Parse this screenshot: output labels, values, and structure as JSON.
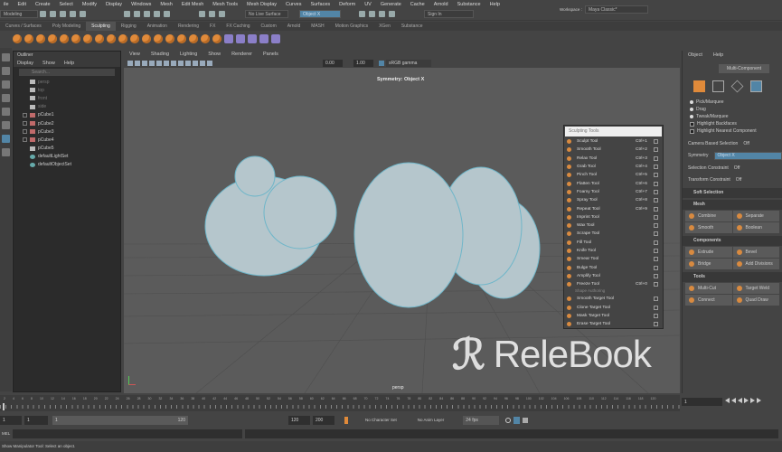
{
  "menubar": [
    "ile",
    "Edit",
    "Create",
    "Select",
    "Modify",
    "Display",
    "Windows",
    "Mesh",
    "Edit Mesh",
    "Mesh Tools",
    "Mesh Display",
    "Curves",
    "Surfaces",
    "Deform",
    "UV",
    "Generate",
    "Cache",
    "Arnold",
    "Substance",
    "Help"
  ],
  "toolbar": {
    "mode": "Modeling",
    "live_surface": "No Live Surface",
    "symmetry": "Object X",
    "sign_in": "Sign In",
    "workspace_label": "Workspace :",
    "workspace": "Maya Classic*"
  },
  "shelf_tabs": [
    "Curves / Surfaces",
    "Poly Modeling",
    "Sculpting",
    "Rigging",
    "Animation",
    "Rendering",
    "FX",
    "FX Caching",
    "Custom",
    "Arnold",
    "MASH",
    "Motion Graphics",
    "XGen",
    "Substance"
  ],
  "shelf_active": "Sculpting",
  "outliner": {
    "title": "Outliner",
    "menu": [
      "Display",
      "Show",
      "Help"
    ],
    "search_placeholder": "Search...",
    "items": [
      {
        "label": "persp",
        "kind": "cam"
      },
      {
        "label": "top",
        "kind": "cam"
      },
      {
        "label": "front",
        "kind": "cam"
      },
      {
        "label": "side",
        "kind": "cam"
      },
      {
        "label": "pCube1",
        "kind": "mesh"
      },
      {
        "label": "pCube2",
        "kind": "mesh"
      },
      {
        "label": "pCube3",
        "kind": "mesh"
      },
      {
        "label": "pCube4",
        "kind": "mesh"
      },
      {
        "label": "pCube5",
        "kind": "group"
      },
      {
        "label": "defaultLightSet",
        "kind": "set"
      },
      {
        "label": "defaultObjectSet",
        "kind": "set"
      }
    ]
  },
  "viewport": {
    "menu": [
      "View",
      "Shading",
      "Lighting",
      "Show",
      "Renderer",
      "Panels"
    ],
    "field1": "0.00",
    "field2": "1.00",
    "color_space": "sRGB gamma",
    "symmetry_label": "Symmetry: Object X",
    "camera": "persp"
  },
  "sculpt_panel": {
    "title": "Sculpting Tools",
    "tools": [
      {
        "n": "Sculpt Tool",
        "k": "Ctrl+1"
      },
      {
        "n": "Smooth Tool",
        "k": "Ctrl+2"
      },
      {
        "n": "Relax Tool",
        "k": "Ctrl+3"
      },
      {
        "n": "Grab Tool",
        "k": "Ctrl+4"
      },
      {
        "n": "Pinch Tool",
        "k": "Ctrl+5"
      },
      {
        "n": "Flatten Tool",
        "k": "Ctrl+6"
      },
      {
        "n": "Foamy Tool",
        "k": "Ctrl+7"
      },
      {
        "n": "Spray Tool",
        "k": "Ctrl+8"
      },
      {
        "n": "Repeat Tool",
        "k": "Ctrl+9"
      },
      {
        "n": "Imprint Tool",
        "k": ""
      },
      {
        "n": "Wax Tool",
        "k": ""
      },
      {
        "n": "Scrape Tool",
        "k": ""
      },
      {
        "n": "Fill Tool",
        "k": ""
      },
      {
        "n": "Knife Tool",
        "k": ""
      },
      {
        "n": "Smear Tool",
        "k": ""
      },
      {
        "n": "Bulge Tool",
        "k": ""
      },
      {
        "n": "Amplify Tool",
        "k": ""
      },
      {
        "n": "Freeze Tool",
        "k": "Ctrl+0"
      }
    ],
    "section": "Shape Authoring",
    "shape_tools": [
      {
        "n": "Smooth Target Tool",
        "k": ""
      },
      {
        "n": "Clone Target Tool",
        "k": ""
      },
      {
        "n": "Mask Target Tool",
        "k": ""
      },
      {
        "n": "Erase Target Tool",
        "k": ""
      }
    ]
  },
  "right_panel": {
    "menu": [
      "Object",
      "Help"
    ],
    "multi_component": "Multi-Component",
    "pick_options": [
      "Pick/Marquee",
      "Drag",
      "Tweak/Marquee"
    ],
    "checks": [
      "Highlight Backfaces",
      "Highlight Nearest Component"
    ],
    "fields": [
      {
        "l": "Camera Based Selection",
        "v": "Off"
      },
      {
        "l": "Symmetry",
        "v": "Object X"
      },
      {
        "l": "Selection Constraint",
        "v": "Off"
      },
      {
        "l": "Transform Constraint",
        "v": "Off"
      }
    ],
    "soft_selection": "Soft Selection",
    "sections": [
      {
        "title": "Mesh",
        "buttons": [
          "Combine",
          "Separate",
          "Smooth",
          "Boolean"
        ]
      },
      {
        "title": "Components",
        "buttons": [
          "Extrude",
          "Bevel",
          "Bridge",
          "Add Divisions"
        ]
      },
      {
        "title": "Tools",
        "buttons": [
          "Multi-Cut",
          "Target Weld",
          "Connect",
          "Quad Draw"
        ]
      }
    ]
  },
  "timeline": {
    "ticks": [
      "2",
      "4",
      "6",
      "8",
      "10",
      "12",
      "14",
      "16",
      "18",
      "20",
      "22",
      "24",
      "26",
      "28",
      "30",
      "32",
      "34",
      "36",
      "38",
      "40",
      "42",
      "44",
      "46",
      "48",
      "50",
      "52",
      "54",
      "56",
      "58",
      "60",
      "62",
      "64",
      "66",
      "68",
      "70",
      "72",
      "74",
      "76",
      "78",
      "80",
      "82",
      "84",
      "86",
      "88",
      "90",
      "92",
      "94",
      "96",
      "98",
      "100",
      "102",
      "104",
      "106",
      "108",
      "110",
      "112",
      "114",
      "116",
      "118",
      "120"
    ],
    "current_frame": "1"
  },
  "range": {
    "start": "1",
    "inner_start": "1",
    "slider_start": "1",
    "slider_end": "120",
    "end": "120",
    "max_end": "200",
    "character_set": "No Character Set",
    "anim_layer": "No Anim Layer",
    "fps": "24 fps"
  },
  "mel": {
    "label": "MEL"
  },
  "status": "Show Manipulator Tool: Select an object.",
  "watermark": "ReleBook"
}
